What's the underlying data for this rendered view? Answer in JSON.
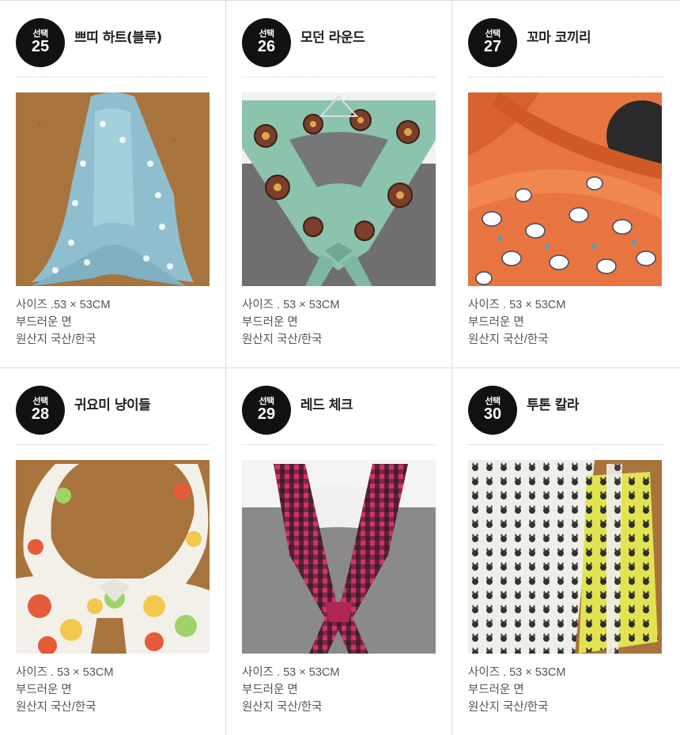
{
  "products": [
    {
      "badge_label": "선택",
      "number": "25",
      "title": "쁘띠 하트(블루)",
      "size": "사이즈 .53 × 53CM",
      "material": "부드러운 면",
      "origin": "원산지 국산/한국",
      "image_icon": "blue-heart-scarf-photo"
    },
    {
      "badge_label": "선택",
      "number": "26",
      "title": "모던 라운드",
      "size": "사이즈 . 53 × 53CM",
      "material": "부드러운 면",
      "origin": "원산지 국산/한국",
      "image_icon": "mint-round-pattern-scarf-photo"
    },
    {
      "badge_label": "선택",
      "number": "27",
      "title": "꼬마 코끼리",
      "size": "사이즈 . 53 × 53CM",
      "material": "부드러운 면",
      "origin": "원산지 국산/한국",
      "image_icon": "orange-elephant-scarf-photo"
    },
    {
      "badge_label": "선택",
      "number": "28",
      "title": "귀요미 냥이들",
      "size": "사이즈 . 53 × 53CM",
      "material": "부드러운 면",
      "origin": "원산지 국산/한국",
      "image_icon": "cat-print-scarf-photo"
    },
    {
      "badge_label": "선택",
      "number": "29",
      "title": "레드 체크",
      "size": "사이즈 . 53 × 53CM",
      "material": "부드러운 면",
      "origin": "원산지 국산/한국",
      "image_icon": "red-check-scarf-photo"
    },
    {
      "badge_label": "선택",
      "number": "30",
      "title": "투톤 칼라",
      "size": "사이즈 . 53 × 53CM",
      "material": "부드러운 면",
      "origin": "원산지 국산/한국",
      "image_icon": "two-tone-cat-scarf-photo"
    }
  ],
  "colors": {
    "badge": "#111111",
    "divider": "#dcdcdc",
    "text": "#555555",
    "title": "#222222"
  }
}
